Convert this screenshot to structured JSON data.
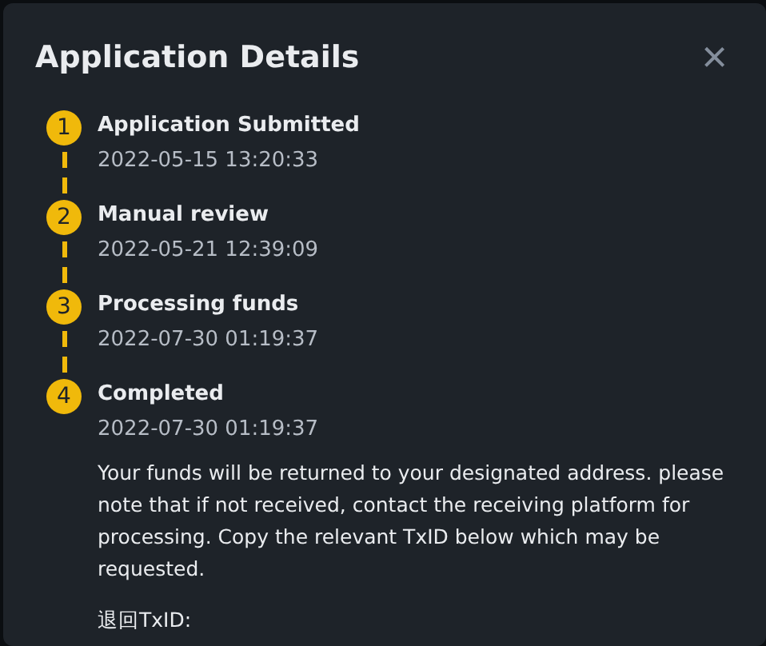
{
  "dialog": {
    "title": "Application Details",
    "close": "×"
  },
  "steps": [
    {
      "number": "1",
      "title": "Application Submitted",
      "time": "2022-05-15 13:20:33"
    },
    {
      "number": "2",
      "title": "Manual review",
      "time": "2022-05-21 12:39:09"
    },
    {
      "number": "3",
      "title": "Processing funds",
      "time": "2022-07-30 01:19:37"
    },
    {
      "number": "4",
      "title": "Completed",
      "time": "2022-07-30 01:19:37",
      "description": "Your funds will be returned to your designated address. please note that if not received, contact the receiving platform for processing. Copy the relevant TxID below which may be requested."
    }
  ],
  "txid_label": "退回TxID:"
}
